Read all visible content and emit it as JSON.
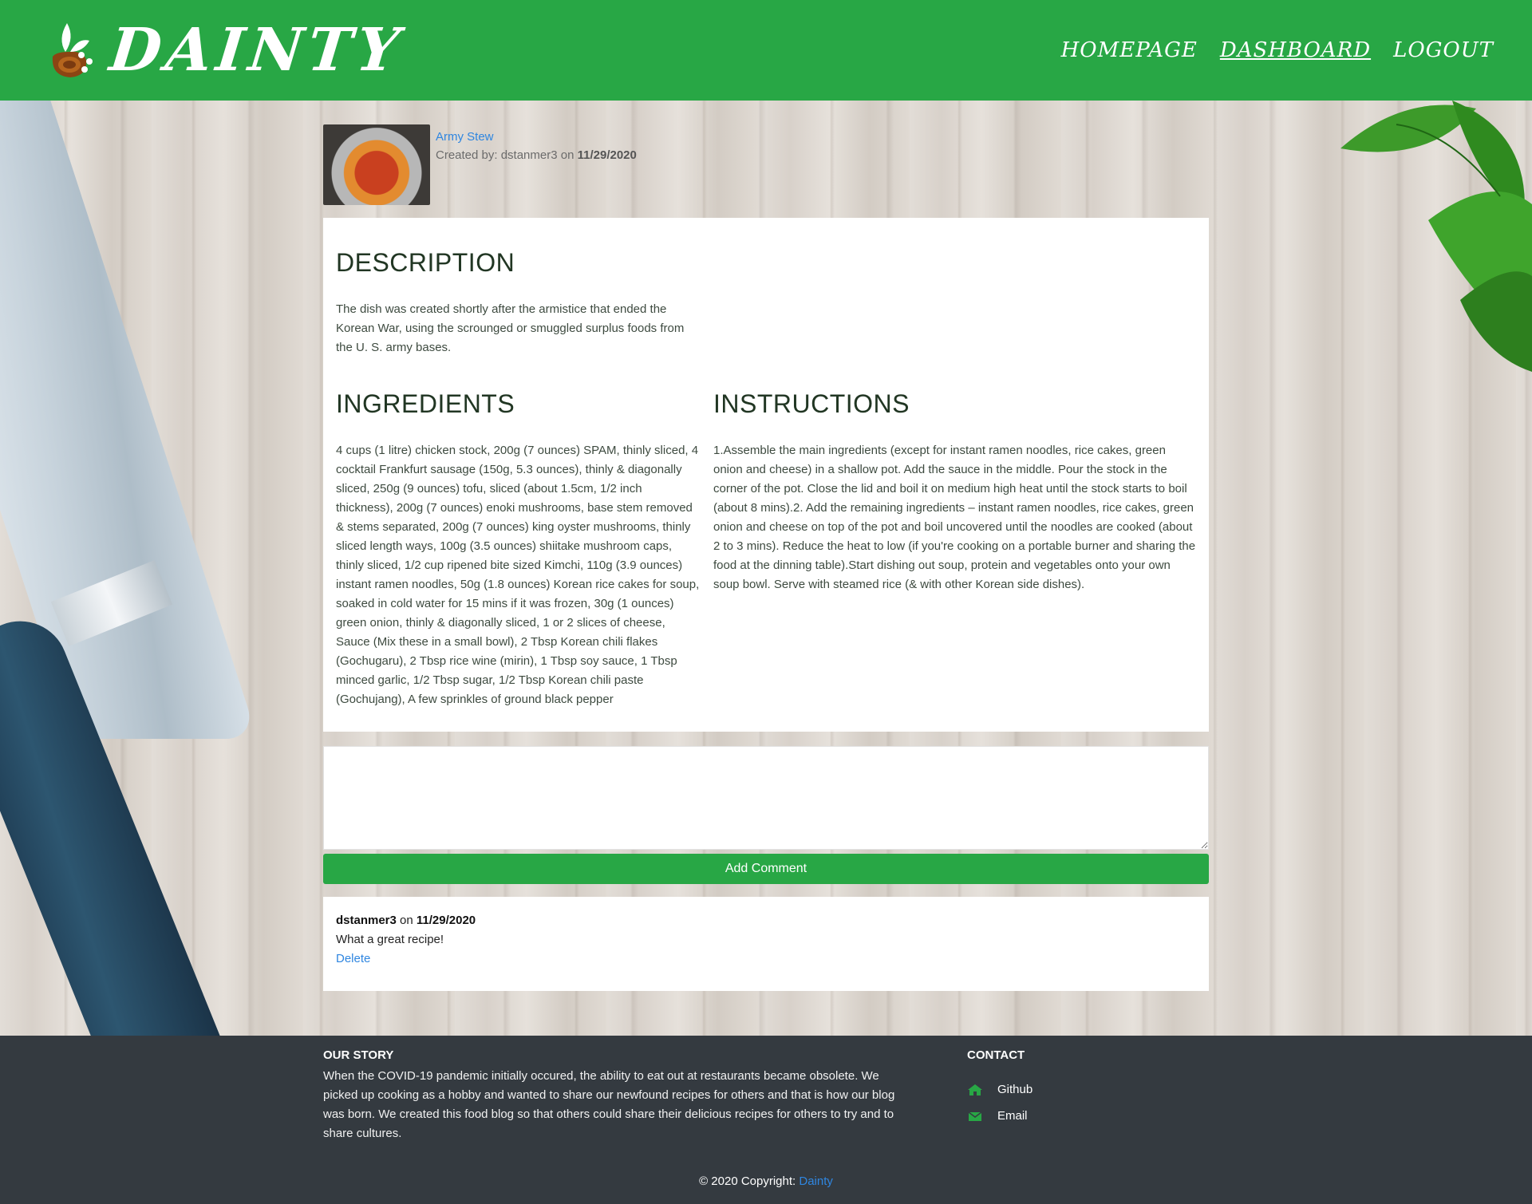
{
  "header": {
    "brand": "DAINTY",
    "nav": [
      "HOMEPAGE",
      "DASHBOARD",
      "LOGOUT"
    ],
    "active_nav": "DASHBOARD",
    "accent_color": "#28a745"
  },
  "recipe": {
    "title": "Army Stew",
    "created_prefix": "Created by: dstanmer3 on",
    "created_date": "11/29/2020"
  },
  "description": {
    "heading": "DESCRIPTION",
    "text": "The dish was created shortly after the armistice that ended the Korean War, using the scrounged or smuggled surplus foods from the U. S. army bases."
  },
  "ingredients": {
    "heading": "INGREDIENTS",
    "text": "4 cups (1 litre) chicken stock, 200g (7 ounces) SPAM, thinly sliced, 4 cocktail Frankfurt sausage (150g, 5.3 ounces), thinly & diagonally sliced, 250g (9 ounces) tofu, sliced (about 1.5cm, 1/2 inch thickness), 200g (7 ounces) enoki mushrooms, base stem removed & stems separated, 200g (7 ounces) king oyster mushrooms, thinly sliced length ways, 100g (3.5 ounces) shiitake mushroom caps, thinly sliced, 1/2 cup ripened bite sized Kimchi, 110g (3.9 ounces) instant ramen noodles, 50g (1.8 ounces) Korean rice cakes for soup, soaked in cold water for 15 mins if it was frozen, 30g (1 ounces) green onion, thinly & diagonally sliced, 1 or 2 slices of cheese, Sauce (Mix these in a small bowl), 2 Tbsp Korean chili flakes (Gochugaru), 2 Tbsp rice wine (mirin), 1 Tbsp soy sauce, 1 Tbsp minced garlic, 1/2 Tbsp sugar, 1/2 Tbsp Korean chili paste (Gochujang), A few sprinkles of ground black pepper"
  },
  "instructions": {
    "heading": "INSTRUCTIONS",
    "text": "1.Assemble the main ingredients (except for instant ramen noodles, rice cakes, green onion and cheese) in a shallow pot. Add the sauce in the middle. Pour the stock in the corner of the pot. Close the lid and boil it on medium high heat until the stock starts to boil (about 8 mins).2. Add the remaining ingredients – instant ramen noodles, rice cakes, green onion and cheese on top of the pot and boil uncovered until the noodles are cooked (about 2 to 3 mins). Reduce the heat to low (if you're cooking on a portable burner and sharing the food at the dinning table).Start dishing out soup, protein and vegetables onto your own soup bowl. Serve with steamed rice (& with other Korean side dishes)."
  },
  "comment_form": {
    "value": "",
    "button": "Add Comment"
  },
  "comments": [
    {
      "author": "dstanmer3",
      "on": "on",
      "date": "11/29/2020",
      "text": "What a great recipe!",
      "delete": "Delete"
    }
  ],
  "footer": {
    "story_heading": "OUR STORY",
    "story_text": "When the COVID-19 pandemic initially occured, the ability to eat out at restaurants became obsolete. We picked up cooking as a hobby and wanted to share our newfound recipes for others and that is how our blog was born. We created this food blog so that others could share their delicious recipes for others to try and to share cultures.",
    "contact_heading": "CONTACT",
    "contacts": [
      {
        "icon": "home-icon",
        "label": "Github"
      },
      {
        "icon": "envelope-icon",
        "label": "Email"
      }
    ],
    "copyright_prefix": "© 2020 Copyright:",
    "copyright_link": "Dainty"
  }
}
